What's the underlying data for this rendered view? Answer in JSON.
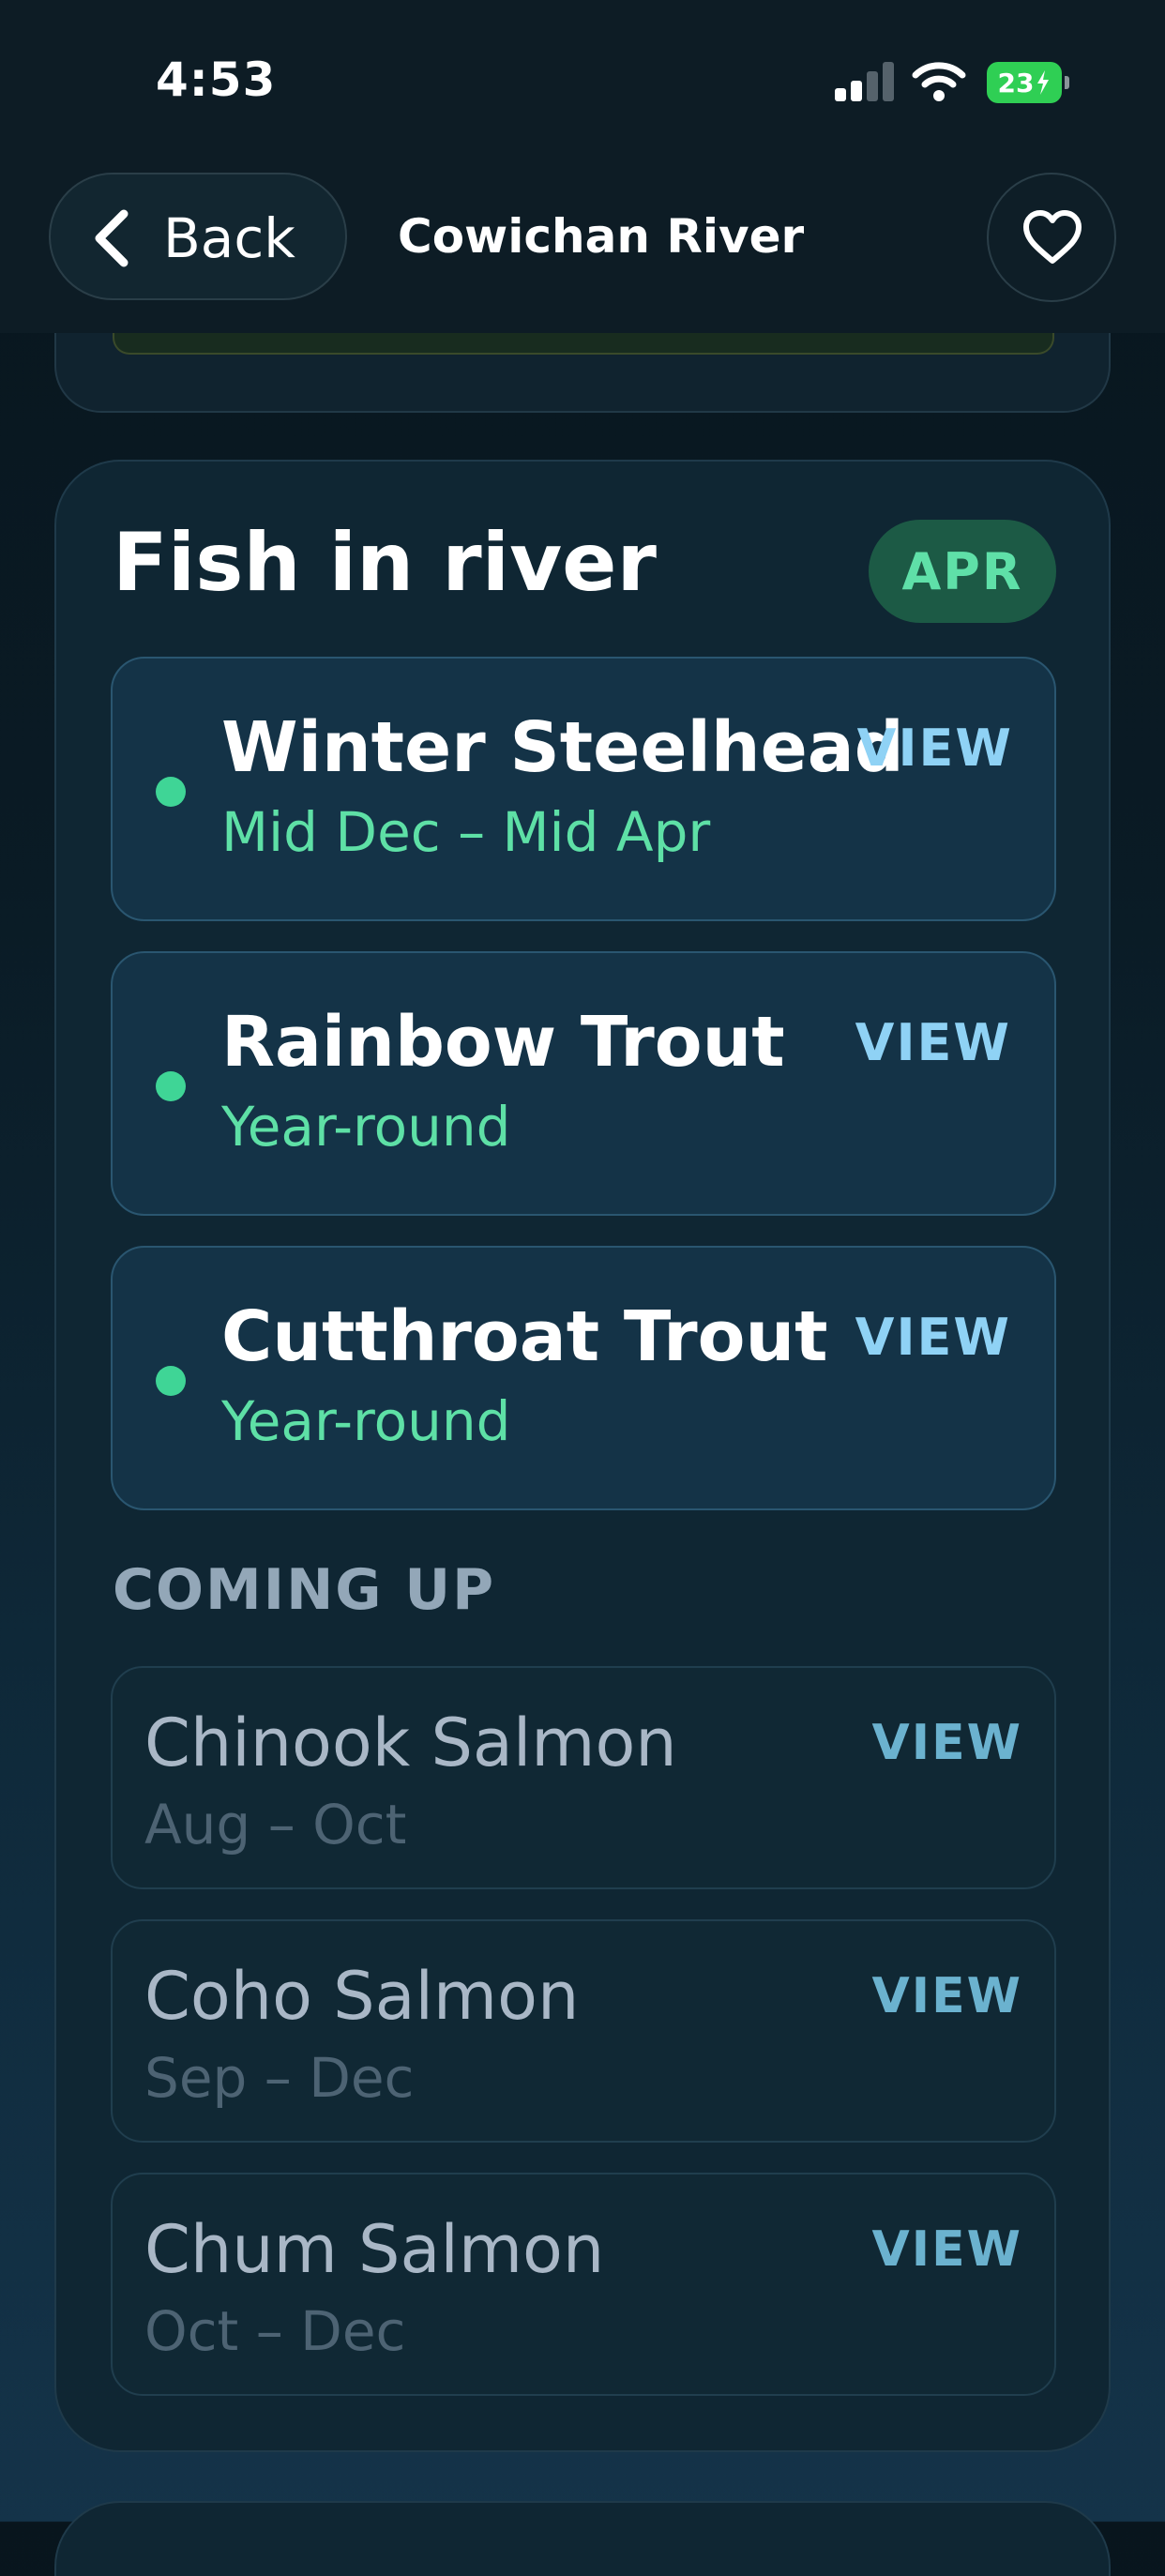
{
  "status_bar": {
    "time": "4:53",
    "battery": "23",
    "signal_bars": 2,
    "signal_total": 4,
    "icons": [
      "signal-icon",
      "wifi-icon",
      "battery-charging-icon"
    ]
  },
  "nav": {
    "back_label": "Back",
    "title": "Cowichan River",
    "favorite_icon": "heart-icon"
  },
  "fish_section": {
    "title": "Fish in river",
    "month_badge": "APR",
    "in_season": [
      {
        "name": "Winter Steelhead",
        "season": "Mid Dec – Mid Apr",
        "action": "VIEW"
      },
      {
        "name": "Rainbow Trout",
        "season": "Year-round",
        "action": "VIEW"
      },
      {
        "name": "Cutthroat Trout",
        "season": "Year-round",
        "action": "VIEW"
      }
    ],
    "coming_up_label": "COMING UP",
    "coming_up": [
      {
        "name": "Chinook Salmon",
        "season": "Aug – Oct",
        "action": "VIEW"
      },
      {
        "name": "Coho Salmon",
        "season": "Sep – Dec",
        "action": "VIEW"
      },
      {
        "name": "Chum Salmon",
        "season": "Oct – Dec",
        "action": "VIEW"
      }
    ]
  },
  "colors": {
    "accent_green": "#5ee0a6",
    "view_blue": "#8fd2f5",
    "badge_bg": "#1c5a45",
    "muted_text": "#a9b7c6"
  }
}
